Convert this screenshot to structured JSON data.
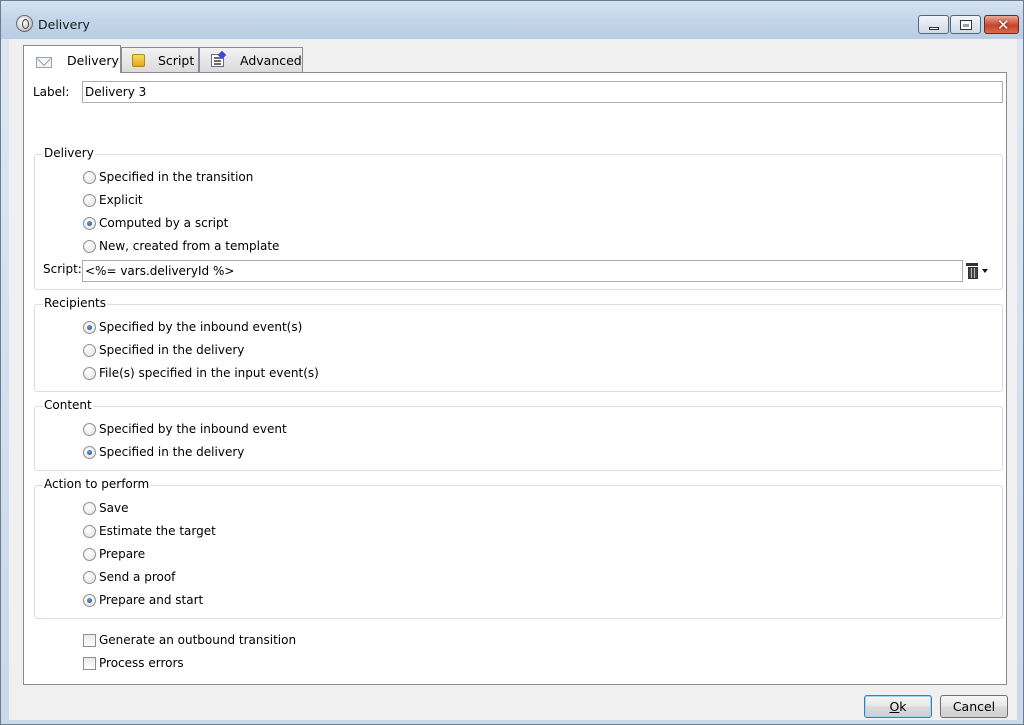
{
  "window": {
    "title": "Delivery"
  },
  "tabs": [
    {
      "label": "Delivery",
      "icon": "envelope-icon",
      "active": true
    },
    {
      "label": "Script",
      "icon": "script-icon",
      "active": false
    },
    {
      "label": "Advanced",
      "icon": "advanced-icon",
      "active": false
    }
  ],
  "label_field": {
    "label": "Label:",
    "value": "Delivery 3"
  },
  "delivery": {
    "title": "Delivery",
    "options": [
      {
        "label": "Specified in the transition",
        "selected": false
      },
      {
        "label": "Explicit",
        "selected": false
      },
      {
        "label": "Computed by a script",
        "selected": true
      },
      {
        "label": "New, created from a template",
        "selected": false
      }
    ],
    "script_label": "Script:",
    "script_value": "<%= vars.deliveryId %>"
  },
  "recipients": {
    "title": "Recipients",
    "options": [
      {
        "label": "Specified by the inbound event(s)",
        "selected": true
      },
      {
        "label": "Specified in the delivery",
        "selected": false
      },
      {
        "label": "File(s) specified in the input event(s)",
        "selected": false
      }
    ]
  },
  "content": {
    "title": "Content",
    "options": [
      {
        "label": "Specified by the inbound event",
        "selected": false
      },
      {
        "label": "Specified in the delivery",
        "selected": true
      }
    ]
  },
  "action": {
    "title": "Action to perform",
    "options": [
      {
        "label": "Save",
        "selected": false
      },
      {
        "label": "Estimate the target",
        "selected": false
      },
      {
        "label": "Prepare",
        "selected": false
      },
      {
        "label": "Send a proof",
        "selected": false
      },
      {
        "label": "Prepare and start",
        "selected": true
      }
    ]
  },
  "checkboxes": [
    {
      "label": "Generate an outbound transition",
      "checked": false
    },
    {
      "label": "Process errors",
      "checked": false
    }
  ],
  "buttons": {
    "ok_first": "O",
    "ok_rest": "k",
    "cancel": "Cancel"
  }
}
